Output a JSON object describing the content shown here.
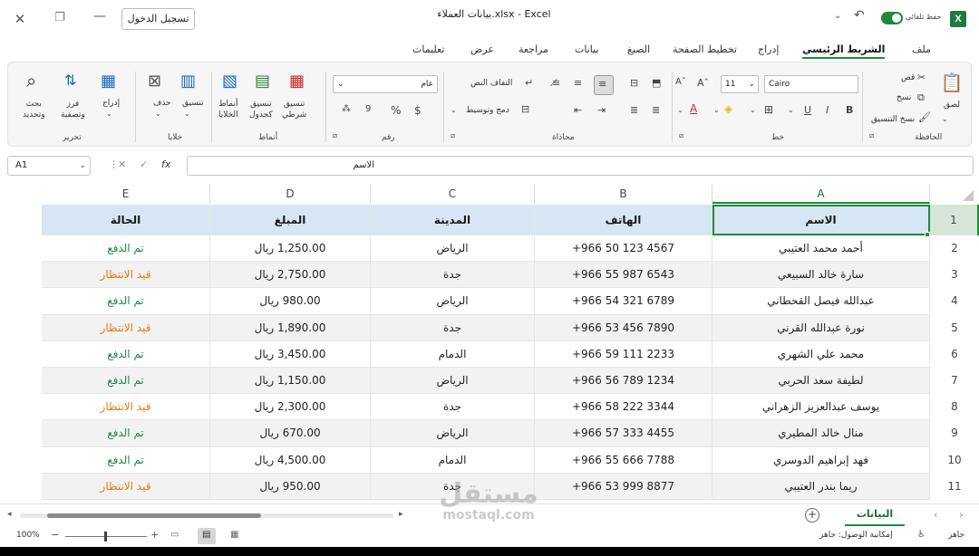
{
  "window": {
    "title": "بيانات العملاء.xlsx  -  Excel",
    "login_label": "تسجيل الدخول",
    "autosave_label": "حفظ تلقائي",
    "close_glyph": "✕",
    "restore_glyph": "❐",
    "minimize_glyph": "—"
  },
  "tabs": {
    "file": "ملف",
    "home": "الشريط الرئيسي",
    "insert": "إدراج",
    "page_layout": "تخطيط الصفحة",
    "formulas": "الصيغ",
    "data": "بيانات",
    "review": "مراجعة",
    "view": "عرض",
    "help": "تعليمات"
  },
  "ribbon": {
    "clipboard": {
      "paste": "لصق",
      "cut": "قص",
      "copy": "نسخ",
      "format_painter": "نسخ التنسيق",
      "group": "الحافظة"
    },
    "font": {
      "name": "Cairo",
      "size": "11",
      "bold": "B",
      "italic": "I",
      "underline": "U",
      "group": "خط"
    },
    "alignment": {
      "wrap": "التفاف النص",
      "merge": "دمج وتوسيط",
      "group": "محاذاة"
    },
    "number": {
      "format": "عام",
      "currency": "$",
      "percent": "%",
      "comma": "9",
      "group": "رقم"
    },
    "styles": {
      "conditional": "تنسيق\nشرطي",
      "as_table": "تنسيق\nكجدول",
      "cell_styles": "أنماط\nالخلايا",
      "group": "أنماط"
    },
    "cells": {
      "insert": "إدراج",
      "delete": "حذف",
      "format": "تنسيق",
      "group": "خلايا"
    },
    "editing": {
      "sort_filter": "فرز\nوتصفية",
      "find_select": "بحث\nوتحديد",
      "group": "تحرير"
    }
  },
  "formula_bar": {
    "name_box": "A1",
    "fx": "fx",
    "value": "الاسم"
  },
  "columns": [
    "A",
    "B",
    "C",
    "D",
    "E"
  ],
  "rows": [
    "1",
    "2",
    "3",
    "4",
    "5",
    "6",
    "7",
    "8",
    "9",
    "10",
    "11"
  ],
  "table": {
    "headers": [
      "الاسم",
      "الهاتف",
      "المدينة",
      "المبلغ",
      "الحالة"
    ],
    "records": [
      [
        "أحمد محمد العتيبي",
        "+966 50 123 4567",
        "الرياض",
        "1,250.00 ريال",
        "تم الدفع"
      ],
      [
        "سارة خالد السبيعي",
        "+966 55 987 6543",
        "جدة",
        "2,750.00 ريال",
        "قيد الانتظار"
      ],
      [
        "عبدالله فيصل القحطاني",
        "+966 54 321 6789",
        "الرياض",
        "980.00 ريال",
        "تم الدفع"
      ],
      [
        "نورة عبدالله القرني",
        "+966 53 456 7890",
        "جدة",
        "1,890.00 ريال",
        "قيد الانتظار"
      ],
      [
        "محمد علي الشهري",
        "+966 59 111 2233",
        "الدمام",
        "3,450.00 ريال",
        "تم الدفع"
      ],
      [
        "لطيفة سعد الحربي",
        "+966 56 789 1234",
        "الرياض",
        "1,150.00 ريال",
        "تم الدفع"
      ],
      [
        "يوسف عبدالعزيز الزهراني",
        "+966 58 222 3344",
        "جدة",
        "2,300.00 ريال",
        "قيد الانتظار"
      ],
      [
        "منال خالد المطيري",
        "+966 57 333 4455",
        "الرياض",
        "670.00 ريال",
        "تم الدفع"
      ],
      [
        "فهد إبراهيم الدوسري",
        "+966 55 666 7788",
        "الدمام",
        "4,500.00 ريال",
        "تم الدفع"
      ],
      [
        "ريما بندر العتيبي",
        "+966 53 999 8877",
        "جدة",
        "950.00 ريال",
        "قيد الانتظار"
      ]
    ]
  },
  "sheets": {
    "active": "البيانات"
  },
  "status": {
    "ready": "جاهز",
    "accessibility": "إمكانية الوصول: جاهز",
    "zoom": "100%"
  },
  "watermark": {
    "arabic": "مستقل",
    "latin": "mostaql.com"
  },
  "colors": {
    "accent": "#1e8a3a",
    "header_fill": "#d6e6f4",
    "paid": "#1e8a3a",
    "pending": "#e07b14"
  }
}
